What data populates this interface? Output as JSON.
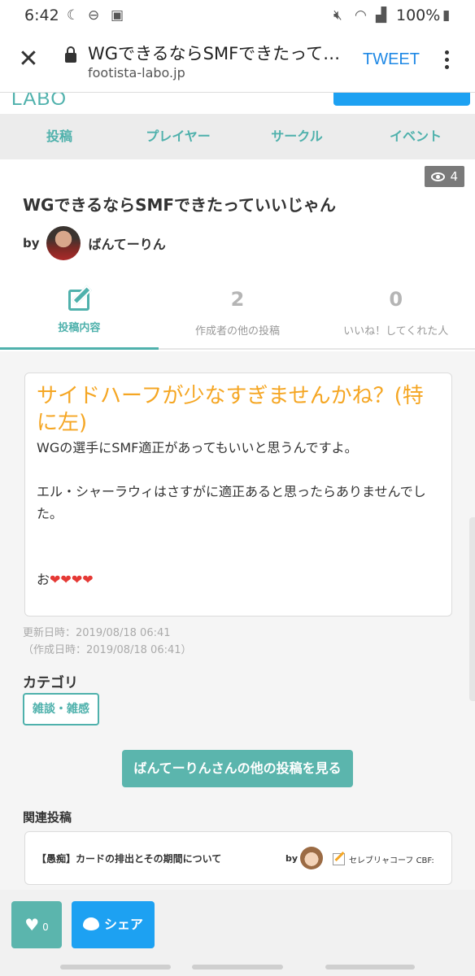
{
  "status_bar": {
    "time": "6:42",
    "battery": "100%"
  },
  "browser": {
    "title": "WGできるならSMFできたって…",
    "url": "footista-labo.jp",
    "tweet_label": "TWEET"
  },
  "site": {
    "logo_text": "LABO"
  },
  "nav": {
    "items": [
      "投稿",
      "プレイヤー",
      "サークル",
      "イベント"
    ]
  },
  "post": {
    "views": "4",
    "title": "WGできるならSMFできたっていいじゃん",
    "by_label": "by",
    "author": "ばんてーりん",
    "heading": "サイドハーフが少なすぎませんかね？(特に左)",
    "body_line1": "WGの選手にSMF適正があってもいいと思うんですよ。",
    "body_line2": "エル・シャーラウィはさすがに適正あると思ったらありませんでした。",
    "body_line3_prefix": "お",
    "body_hearts": "❤❤❤❤",
    "updated": "更新日時：2019/08/18 06:41",
    "created": "（作成日時：2019/08/18 06:41）"
  },
  "stats": [
    {
      "value": "",
      "label": "投稿内容"
    },
    {
      "value": "2",
      "label": "作成者の他の投稿"
    },
    {
      "value": "0",
      "label": "いいね！してくれた人"
    }
  ],
  "category": {
    "label": "カテゴリ",
    "tag": "雑談・雑感"
  },
  "more_button": "ばんてーりんさんの他の投稿を見る",
  "related": {
    "label": "関連投稿",
    "items": [
      {
        "title": "【愚痴】カードの排出とその期間について",
        "by": "by",
        "author": "セレブリャコーフ CBF:"
      }
    ]
  },
  "bottom": {
    "like_count": "0",
    "share_label": "シェア"
  },
  "colors": {
    "accent": "#4fb1ac",
    "heading": "#f5a623",
    "twitter": "#1da1f2"
  }
}
